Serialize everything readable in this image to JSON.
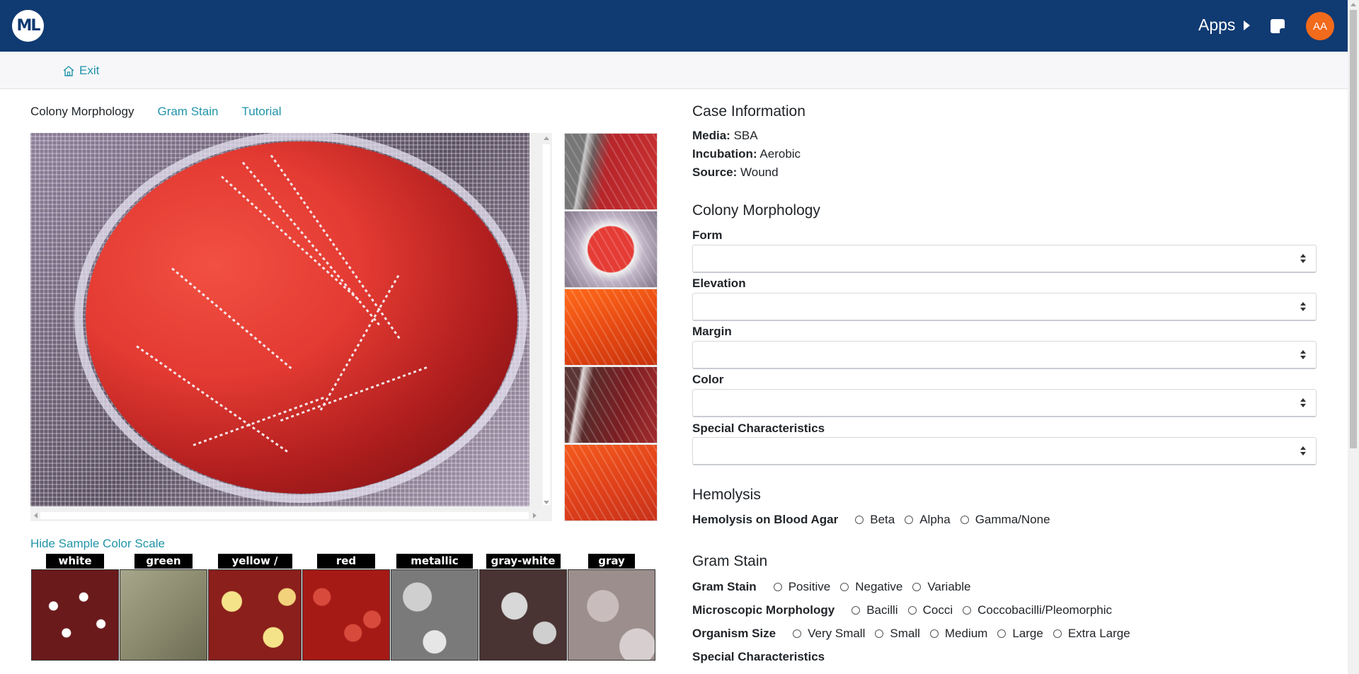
{
  "header": {
    "logo_text": "ML",
    "apps_label": "Apps",
    "avatar_initials": "AA",
    "brand_color": "#103a72",
    "avatar_color": "#f26a1b"
  },
  "subnav": {
    "exit_label": "Exit"
  },
  "tabs": [
    {
      "label": "Colony Morphology",
      "active": true
    },
    {
      "label": "Gram Stain",
      "active": false
    },
    {
      "label": "Tutorial",
      "active": false
    }
  ],
  "color_scale": {
    "toggle_label": "Hide Sample Color Scale",
    "swatches": [
      "white",
      "green",
      "yellow / gold",
      "red",
      "metallic",
      "gray-white",
      "gray"
    ]
  },
  "case_info": {
    "title": "Case Information",
    "media_label": "Media:",
    "media_value": "SBA",
    "incubation_label": "Incubation:",
    "incubation_value": "Aerobic",
    "source_label": "Source:",
    "source_value": "Wound"
  },
  "colony": {
    "title": "Colony Morphology",
    "fields": [
      "Form",
      "Elevation",
      "Margin",
      "Color",
      "Special Characteristics"
    ]
  },
  "hemolysis": {
    "title": "Hemolysis",
    "label": "Hemolysis on Blood Agar",
    "options": [
      "Beta",
      "Alpha",
      "Gamma/None"
    ]
  },
  "gram": {
    "title": "Gram Stain",
    "stain_label": "Gram Stain",
    "stain_options": [
      "Positive",
      "Negative",
      "Variable"
    ],
    "morph_label": "Microscopic Morphology",
    "morph_options": [
      "Bacilli",
      "Cocci",
      "Coccobacilli/Pleomorphic"
    ],
    "size_label": "Organism Size",
    "size_options": [
      "Very Small",
      "Small",
      "Medium",
      "Large",
      "Extra Large"
    ],
    "special_label": "Special Characteristics"
  }
}
